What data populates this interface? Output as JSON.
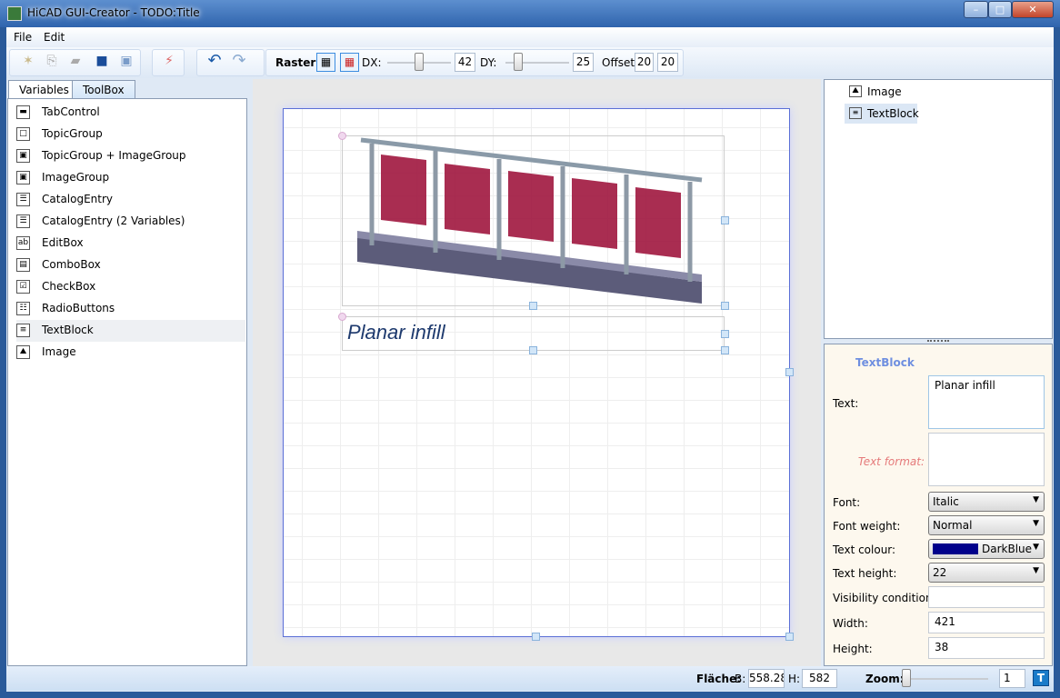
{
  "window": {
    "title": "HiCAD GUI-Creator - TODO:Title"
  },
  "menu": [
    "File",
    "Edit"
  ],
  "toolbar": {
    "raster_label": "Raster:",
    "dx_label": "DX:",
    "dx_value": "42",
    "dy_label": "DY:",
    "dy_value": "25",
    "offset_label": "Offset:",
    "offset_x": "20",
    "offset_y": "20"
  },
  "left_tabs": [
    "Variables",
    "ToolBox"
  ],
  "toolbox": [
    "TabControl",
    "TopicGroup",
    "TopicGroup + ImageGroup",
    "ImageGroup",
    "CatalogEntry",
    "CatalogEntry (2 Variables)",
    "EditBox",
    "ComboBox",
    "CheckBox",
    "RadioButtons",
    "TextBlock",
    "Image"
  ],
  "canvas": {
    "text_block": "Planar infill"
  },
  "tree": [
    "Image",
    "TextBlock"
  ],
  "props": {
    "header": "TextBlock",
    "text_label": "Text:",
    "text_value": "Planar infill",
    "format_label": "Text format:",
    "font_label": "Font:",
    "font_value": "Italic",
    "weight_label": "Font weight:",
    "weight_value": "Normal",
    "colour_label": "Text colour:",
    "colour_value": "DarkBlue",
    "colour_hex": "#00008b",
    "height_label": "Text height:",
    "height_value": "22",
    "visibility_label": "Visibility condition:",
    "width_label": "Width:",
    "width_value": "421",
    "heightval_label": "Height:",
    "heightval_value": "38"
  },
  "status": {
    "flaeche_label": "Fläche:",
    "b_label": "B:",
    "b_value": "558.28",
    "h_label": "H:",
    "h_value": "582",
    "zoom_label": "Zoom:",
    "zoom_value": "1"
  }
}
